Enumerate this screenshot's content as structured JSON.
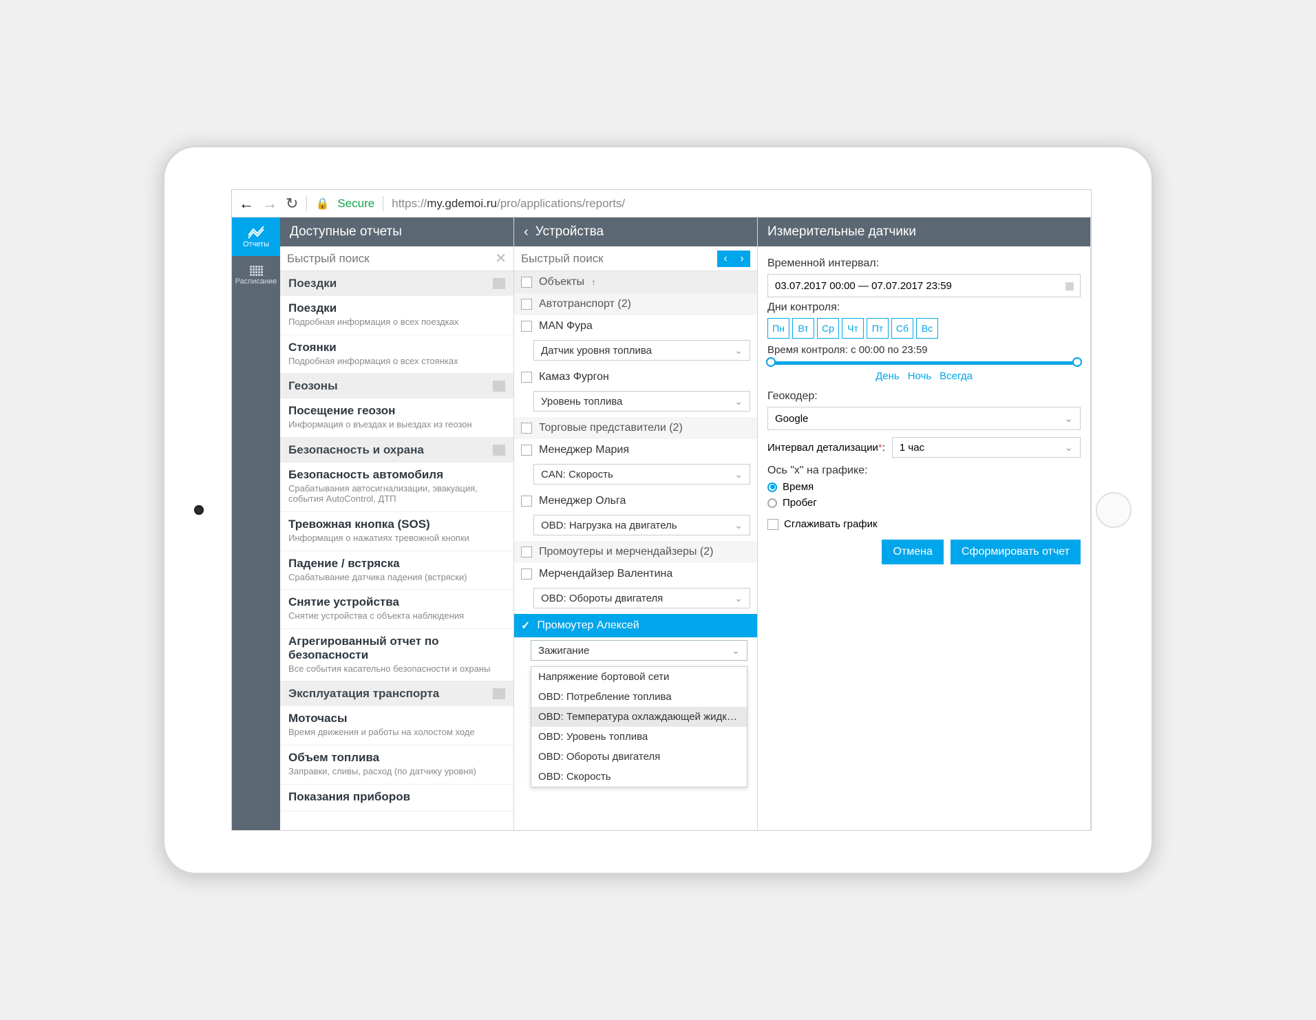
{
  "url": {
    "secure": "Secure",
    "prefix": "https://",
    "host": "my.gdemoi.ru",
    "path": "/pro/applications/reports/"
  },
  "sidebar": {
    "reports": "Отчеты",
    "schedule": "Расписание"
  },
  "reports": {
    "title": "Доступные отчеты",
    "search_placeholder": "Быстрый поиск",
    "groups": [
      {
        "name": "Поездки",
        "items": [
          {
            "title": "Поездки",
            "desc": "Подробная информация о всех поездках"
          },
          {
            "title": "Стоянки",
            "desc": "Подробная информация о всех стоянках"
          }
        ]
      },
      {
        "name": "Геозоны",
        "items": [
          {
            "title": "Посещение геозон",
            "desc": "Информация о въездах и выездах из геозон"
          }
        ]
      },
      {
        "name": "Безопасность и охрана",
        "items": [
          {
            "title": "Безопасность автомобиля",
            "desc": "Срабатывания автосигнализации, эвакуация, события AutoControl, ДТП"
          },
          {
            "title": "Тревожная кнопка (SOS)",
            "desc": "Информация о нажатиях тревожной кнопки"
          },
          {
            "title": "Падение / встряска",
            "desc": "Срабатывание датчика падения (встряски)"
          },
          {
            "title": "Снятие устройства",
            "desc": "Снятие устройства с объекта наблюдения"
          },
          {
            "title": "Агрегированный отчет по безопасности",
            "desc": "Все события касательно безопасности и охраны"
          }
        ]
      },
      {
        "name": "Эксплуатация транспорта",
        "items": [
          {
            "title": "Моточасы",
            "desc": "Время движения и работы на холостом ходе"
          },
          {
            "title": "Объем топлива",
            "desc": "Заправки, сливы, расход (по датчику уровня)"
          },
          {
            "title": "Показания приборов",
            "desc": ""
          }
        ]
      }
    ]
  },
  "devices": {
    "title": "Устройства",
    "search_placeholder": "Быстрый поиск",
    "columns_header": "Объекты",
    "groups": [
      {
        "name": "Автотранспорт (2)",
        "items": [
          {
            "name": "MAN Фура",
            "sensor": "Датчик уровня топлива"
          },
          {
            "name": "Камаз Фургон",
            "sensor": "Уровень топлива"
          }
        ]
      },
      {
        "name": "Торговые представители (2)",
        "items": [
          {
            "name": "Менеджер Мария",
            "sensor": "CAN: Скорость"
          },
          {
            "name": "Менеджер Ольга",
            "sensor": "OBD: Нагрузка на двигатель"
          }
        ]
      },
      {
        "name": "Промоутеры и мерчендайзеры (2)",
        "items": [
          {
            "name": "Мерчендайзер Валентина",
            "sensor": "OBD: Обороты двигателя"
          },
          {
            "name": "Промоутер Алексей",
            "sensor": "Зажигание",
            "selected": true
          }
        ]
      }
    ],
    "dropdown": [
      "Напряжение бортовой сети",
      "OBD: Потребление топлива",
      "OBD: Температура охлаждающей жидкости",
      "OBD: Уровень топлива",
      "OBD: Обороты двигателя",
      "OBD: Скорость"
    ]
  },
  "settings": {
    "title": "Измерительные датчики",
    "time_interval_label": "Временной интервал:",
    "time_interval_value": "03.07.2017 00:00 — 07.07.2017 23:59",
    "control_days_label": "Дни контроля:",
    "days": [
      "Пн",
      "Вт",
      "Ср",
      "Чт",
      "Пт",
      "Сб",
      "Вс"
    ],
    "control_time_label": "Время контроля: с 00:00 по 23:59",
    "presets": {
      "day": "День",
      "night": "Ночь",
      "always": "Всегда"
    },
    "geocoder_label": "Геокодер:",
    "geocoder_value": "Google",
    "detail_label": "Интервал детализации",
    "detail_value": "1 час",
    "xaxis_label": "Ось \"x\" на графике:",
    "xaxis_time": "Время",
    "xaxis_run": "Пробег",
    "smooth_label": "Сглаживать график",
    "cancel": "Отмена",
    "submit": "Сформировать отчет"
  }
}
